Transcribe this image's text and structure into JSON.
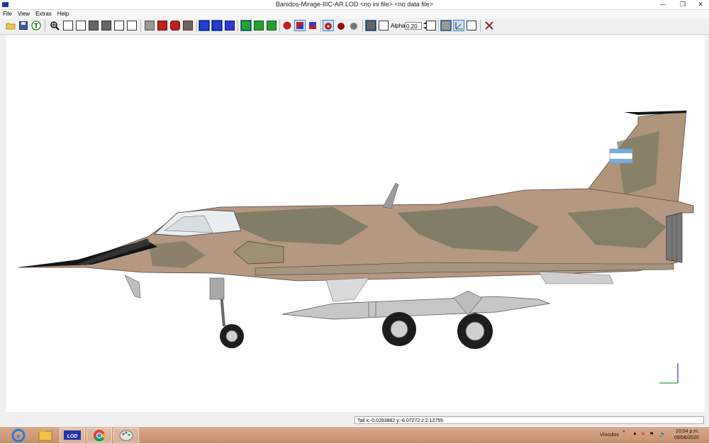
{
  "window": {
    "title": "Banidos-Mirage-IIIC-AR.LOD  <no ini file>  <no data file>",
    "minimize_glyph": "—",
    "restore_glyph": "❐",
    "close_glyph": "✕"
  },
  "menu": {
    "items": [
      {
        "label": "File"
      },
      {
        "label": "View"
      },
      {
        "label": "Extras"
      },
      {
        "label": "Help"
      }
    ]
  },
  "toolbar": {
    "alpha_label": "Alpha:",
    "alpha_value": "0.20"
  },
  "viewport": {
    "model": "Mirage IIIC aircraft (side view)",
    "background": "#ffffff",
    "camo_colors": [
      "#b69781",
      "#7c7a63",
      "#9f9075"
    ],
    "flag_colors": [
      "#74acdf",
      "#ffffff"
    ]
  },
  "status": {
    "text": "Tail    x:-0.0283882 y:-6.07272 z:2.12755"
  },
  "taskbar": {
    "apps": [
      {
        "name": "internet-explorer-icon"
      },
      {
        "name": "file-explorer-icon"
      },
      {
        "name": "lod-viewer-icon",
        "label": "LOD"
      },
      {
        "name": "chrome-icon"
      },
      {
        "name": "paint-icon"
      }
    ],
    "tray_label": "Vínculos",
    "time": "10:04 p.m.",
    "date": "09/06/2020"
  }
}
